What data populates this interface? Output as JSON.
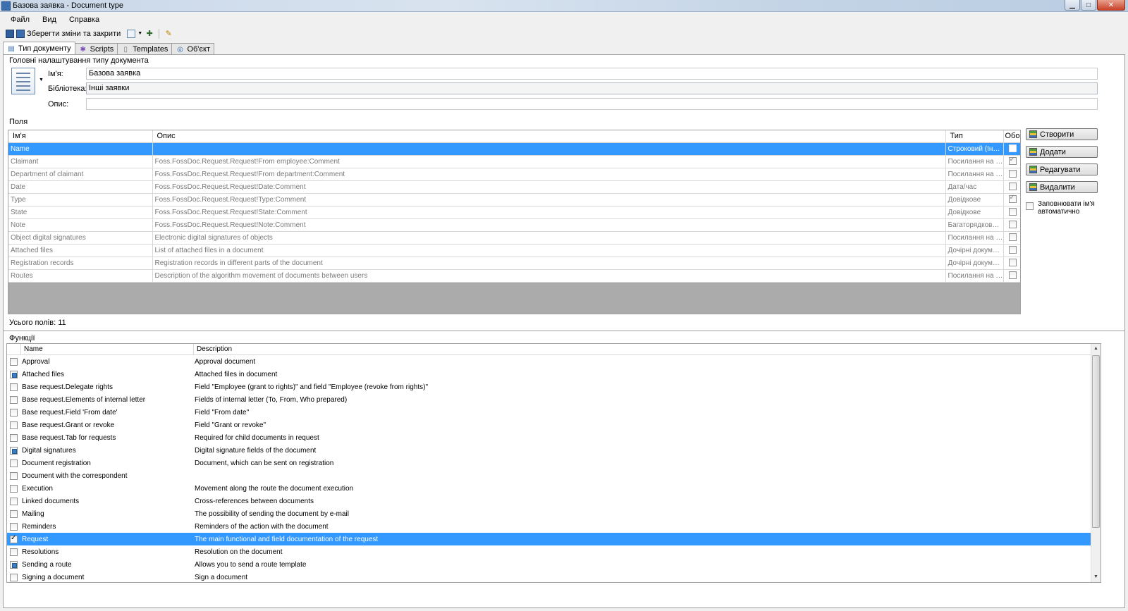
{
  "window": {
    "title": "Базова заявка - Document type"
  },
  "menu": [
    "Файл",
    "Вид",
    "Справка"
  ],
  "toolbar": {
    "save_close_label": "Зберегти зміни та закрити"
  },
  "tabs": [
    {
      "label": "Тип документу",
      "icon": "doctype-icon"
    },
    {
      "label": "Scripts",
      "icon": "scripts-icon"
    },
    {
      "label": "Templates",
      "icon": "templates-icon"
    },
    {
      "label": "Об'єкт",
      "icon": "object-icon"
    }
  ],
  "general": {
    "section_title": "Головні налаштування типу документа",
    "name_label": "Ім'я:",
    "name_value": "Базова заявка",
    "library_label": "Бібліотека:",
    "library_value": "Інші заявки",
    "description_label": "Опис:",
    "description_value": ""
  },
  "fields": {
    "section_title": "Поля",
    "columns": [
      "Ім'я",
      "Опис",
      "Тип",
      "Обо"
    ],
    "rows": [
      {
        "name": "Name",
        "desc": "",
        "type": "Строковий (Інде...",
        "req": true,
        "selected": true
      },
      {
        "name": "Claimant",
        "desc": "Foss.FossDoc.Request.Request!From employee:Comment",
        "type": "Посилання на д...",
        "req": true
      },
      {
        "name": "Department of claimant",
        "desc": "Foss.FossDoc.Request.Request!From department:Comment",
        "type": "Посилання на д...",
        "req": false
      },
      {
        "name": "Date",
        "desc": "Foss.FossDoc.Request.Request!Date:Comment",
        "type": "Дата/час",
        "req": false
      },
      {
        "name": "Type",
        "desc": "Foss.FossDoc.Request.Request!Type:Comment",
        "type": "Довідкове",
        "req": true
      },
      {
        "name": "State",
        "desc": "Foss.FossDoc.Request.Request!State:Comment",
        "type": "Довідкове",
        "req": false
      },
      {
        "name": "Note",
        "desc": "Foss.FossDoc.Request.Request!Note:Comment",
        "type": "Багаторядковий...",
        "req": false
      },
      {
        "name": "Object digital signatures",
        "desc": "Electronic digital signatures of objects",
        "type": "Посилання на д...",
        "req": false
      },
      {
        "name": "Attached files",
        "desc": "List of attached files in a document",
        "type": "Дочірні докумен...",
        "req": false
      },
      {
        "name": "Registration records",
        "desc": "Registration records in different parts of the document",
        "type": "Дочірні докумен...",
        "req": false
      },
      {
        "name": "Routes",
        "desc": "Description of the algorithm movement of documents between users",
        "type": "Посилання на д...",
        "req": false
      }
    ],
    "total_label": "Усього полів: 11"
  },
  "actions": {
    "create": "Створити",
    "add": "Додати",
    "edit": "Редагувати",
    "delete": "Видалити",
    "auto_name": "Заповнювати ім'я автоматично"
  },
  "functions": {
    "section_title": "Функції",
    "columns": [
      "Name",
      "Description"
    ],
    "rows": [
      {
        "name": "Approval",
        "desc": "Approval document",
        "state": "none"
      },
      {
        "name": "Attached files",
        "desc": "Attached files in document",
        "state": "partial"
      },
      {
        "name": "Base request.Delegate rights",
        "desc": "Field \"Employee (grant to rights)\" and field \"Employee (revoke from rights)\"",
        "state": "none"
      },
      {
        "name": "Base request.Elements of internal letter",
        "desc": "Fields of internal letter (To, From, Who prepared)",
        "state": "none"
      },
      {
        "name": "Base request.Field 'From date'",
        "desc": "Field \"From date\"",
        "state": "none"
      },
      {
        "name": "Base request.Grant or revoke",
        "desc": "Field \"Grant or revoke\"",
        "state": "none"
      },
      {
        "name": "Base request.Tab for requests",
        "desc": "Required for child documents in request",
        "state": "none"
      },
      {
        "name": "Digital signatures",
        "desc": "Digital signature fields of the document",
        "state": "partial"
      },
      {
        "name": "Document registration",
        "desc": "Document, which can be sent on registration",
        "state": "none"
      },
      {
        "name": "Document with the correspondent",
        "desc": "",
        "state": "none"
      },
      {
        "name": "Execution",
        "desc": "Movement along the route the document execution",
        "state": "none"
      },
      {
        "name": "Linked documents",
        "desc": "Cross-references between documents",
        "state": "none"
      },
      {
        "name": "Mailing",
        "desc": "The possibility of sending the document by e-mail",
        "state": "none"
      },
      {
        "name": "Reminders",
        "desc": "Reminders of the action with the document",
        "state": "none"
      },
      {
        "name": "Request",
        "desc": "The main functional and field documentation of the request",
        "state": "checked",
        "selected": true
      },
      {
        "name": "Resolutions",
        "desc": "Resolution on the document",
        "state": "none"
      },
      {
        "name": "Sending a route",
        "desc": "Allows you to send a route template",
        "state": "partial"
      },
      {
        "name": "Signing a document",
        "desc": "Sign a document",
        "state": "none"
      }
    ]
  }
}
